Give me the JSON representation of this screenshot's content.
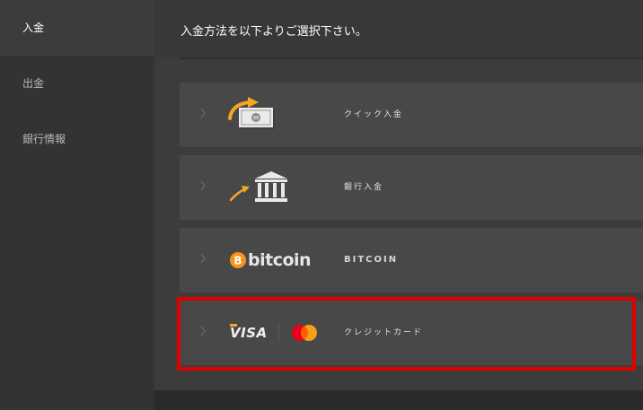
{
  "sidebar": {
    "items": [
      {
        "label": "入金",
        "active": true
      },
      {
        "label": "出金",
        "active": false
      },
      {
        "label": "銀行情報",
        "active": false
      }
    ]
  },
  "header": {
    "title": "入金方法を以下よりご選択下さい。"
  },
  "methods": [
    {
      "label": "クイック入金",
      "icon": "money-transfer-icon"
    },
    {
      "label": "銀行入金",
      "icon": "bank-icon"
    },
    {
      "label": "BITCOIN",
      "icon": "bitcoin-logo",
      "logo_text": "bitcoin"
    },
    {
      "label": "クレジットカード",
      "icon": "visa-mastercard-logo",
      "logo_text": "VISA"
    }
  ],
  "colors": {
    "highlight": "#e00000",
    "accent_orange": "#f5a623",
    "bitcoin_orange": "#f7931a"
  }
}
